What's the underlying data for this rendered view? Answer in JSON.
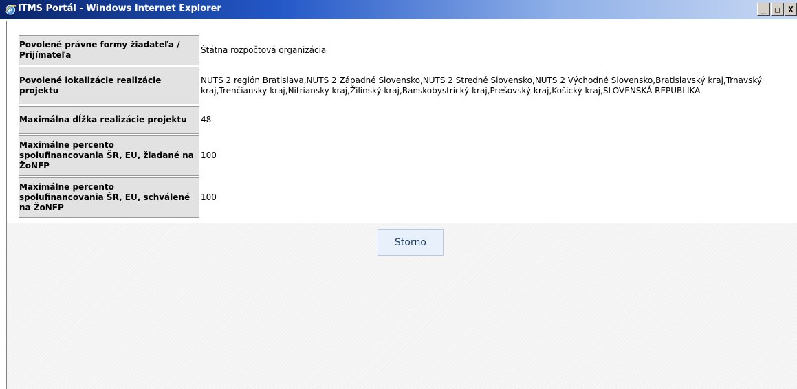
{
  "window": {
    "title": "ITMS Portál - Windows Internet Explorer",
    "controls": {
      "minimize": "_",
      "maximize": "□",
      "close": "X"
    }
  },
  "properties": [
    {
      "label": "Povolené právne formy žiadateľa / Prijímateľa",
      "value": "Štátna rozpočtová organizácia"
    },
    {
      "label": "Povolené lokalizácie realizácie projektu",
      "value": "NUTS 2 región Bratislava,NUTS 2 Západné Slovensko,NUTS 2 Stredné Slovensko,NUTS 2 Východné Slovensko,Bratislavský kraj,Trnavský kraj,Trenčiansky kraj,Nitriansky kraj,Žilinský kraj,Banskobystrický kraj,Prešovský kraj,Košický kraj,SLOVENSKÁ REPUBLIKA"
    },
    {
      "label": "Maximálna dĺžka realizácie projektu",
      "value": "48"
    },
    {
      "label": "Maximálne percento spolufinancovania ŠR, EU, žiadané na ŽoNFP",
      "value": "100"
    },
    {
      "label": "Maximálne percento spolufinancovania ŠR, EU, schválené na ŽoNFP",
      "value": "100"
    }
  ],
  "buttons": {
    "storno": "Storno"
  },
  "colors": {
    "titlebar_start": "#0a246a",
    "label_bg": "#e2e2e2",
    "button_bg": "#e8f0fb"
  }
}
